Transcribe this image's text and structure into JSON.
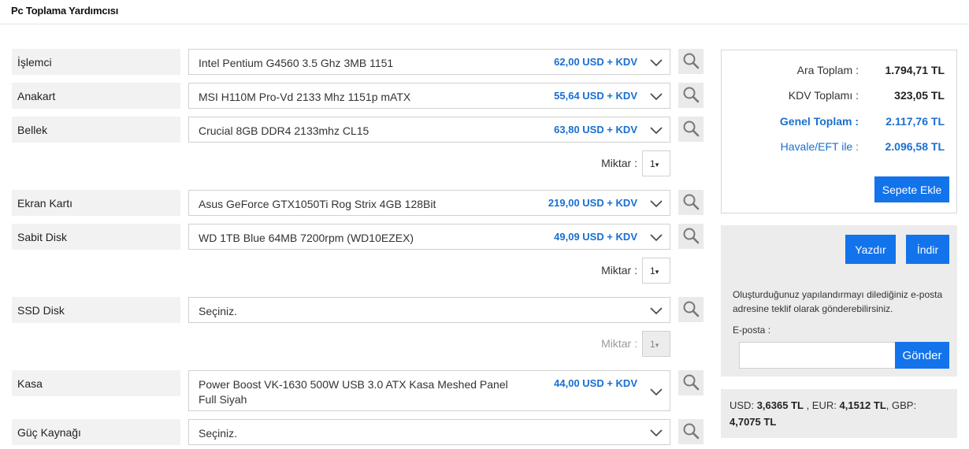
{
  "header": {
    "title": "Pc Toplama Yardımcısı"
  },
  "components": [
    {
      "label": "İşlemci",
      "value": "Intel Pentium G4560 3.5 Ghz 3MB 1151",
      "price": "62,00 USD + KDV"
    },
    {
      "label": "Anakart",
      "value": "MSI H110M Pro-Vd 2133 Mhz 1151p mATX",
      "price": "55,64 USD + KDV"
    },
    {
      "label": "Bellek",
      "value": "Crucial 8GB DDR4 2133mhz CL15",
      "price": "63,80 USD + KDV"
    },
    {
      "label": "Ekran Kartı",
      "value": "Asus GeForce GTX1050Ti Rog Strix 4GB 128Bit",
      "price": "219,00 USD + KDV"
    },
    {
      "label": "Sabit Disk",
      "value": "WD 1TB Blue 64MB 7200rpm (WD10EZEX)",
      "price": "49,09 USD + KDV"
    },
    {
      "label": "SSD Disk",
      "value": "Seçiniz.",
      "price": ""
    },
    {
      "label": "Kasa",
      "value": "Power Boost VK-1630 500W USB 3.0 ATX Kasa Meshed Panel Full Siyah",
      "price": "44,00 USD + KDV"
    },
    {
      "label": "Güç Kaynağı",
      "value": "Seçiniz.",
      "price": ""
    }
  ],
  "quantity": {
    "label": "Miktar :",
    "value": "1",
    "arrow": "▾"
  },
  "summary": {
    "ara_toplam_label": "Ara Toplam :",
    "ara_toplam_value": "1.794,71 TL",
    "kdv_label": "KDV Toplamı :",
    "kdv_value": "323,05 TL",
    "genel_label": "Genel Toplam :",
    "genel_value": "2.117,76 TL",
    "havale_label": "Havale/EFT ile :",
    "havale_value": "2.096,58 TL",
    "add_to_cart": "Sepete Ekle"
  },
  "actions": {
    "print": "Yazdır",
    "download": "İndir",
    "share_text": "Oluşturduğunuz yapılandırmayı dilediğiniz e-posta adresine teklif olarak gönderebilirsiniz.",
    "email_label": "E-posta :",
    "email_value": "",
    "send": "Gönder"
  },
  "rates": {
    "usd_label": "USD:",
    "usd_value": "3,6365 TL",
    "eur_label": ", EUR:",
    "eur_value": "4,1512 TL",
    "gbp_label": ", GBP:",
    "gbp_value": "4,7075 TL"
  },
  "icons": {
    "search": "search-icon",
    "chevron": "chevron-down-icon"
  },
  "colors": {
    "accent": "#1273eb",
    "price": "#1a6fd0",
    "label_bg": "#f2f2f2",
    "panel_bg": "#ececec"
  }
}
